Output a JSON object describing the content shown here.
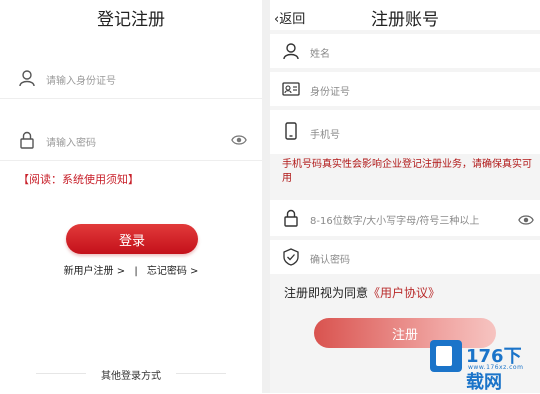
{
  "login": {
    "title": "登记注册",
    "id_placeholder": "请输入身份证号",
    "password_placeholder": "请输入密码",
    "notice": "【阅读：系统使用须知】",
    "login_button": "登录",
    "register_link": "新用户注册 >",
    "separator": "|",
    "forgot_link": "忘记密码 >",
    "other_login": "其他登录方式"
  },
  "register": {
    "back_label": "返回",
    "title": "注册账号",
    "name_placeholder": "姓名",
    "id_placeholder": "身份证号",
    "phone_placeholder": "手机号",
    "warning": "手机号码真实性会影响企业登记注册业务，请确保真实可用",
    "password_placeholder": "8-16位数字/大小写字母/符号三种以上",
    "confirm_placeholder": "确认密码",
    "agree_prefix": "注册即视为同意",
    "agree_link": "《用户协议》",
    "register_button": "注册"
  },
  "watermark": {
    "brand": "176下载网",
    "url": "www.176xz.com"
  }
}
